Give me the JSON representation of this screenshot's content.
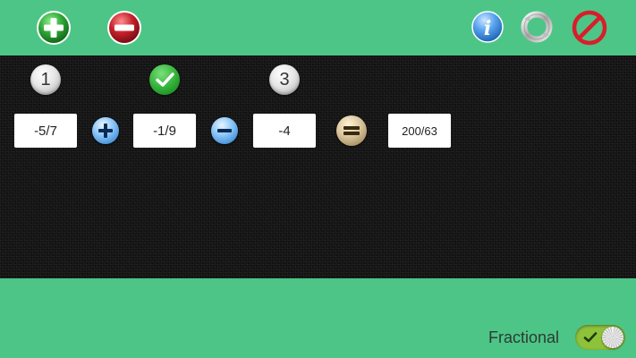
{
  "toolbar": {
    "icons": [
      "add-icon",
      "remove-icon",
      "info-icon",
      "refresh-icon",
      "prohibited-icon"
    ]
  },
  "steps": {
    "labels": [
      "1",
      "3"
    ],
    "check_icon": "check-icon"
  },
  "expression": {
    "operand1": "-5/7",
    "operator1": "plus",
    "operand2": "-1/9",
    "operator2": "minus",
    "operand3": "-4",
    "equals": "equals",
    "result": "200/63"
  },
  "mode": {
    "label": "Fractional",
    "enabled": true
  },
  "colors": {
    "background": "#4dc587",
    "panel": "#141414",
    "add": "#2ea636",
    "remove": "#c4202a",
    "info": "#2d7fd6",
    "toggle_on": "#8ec23b"
  }
}
